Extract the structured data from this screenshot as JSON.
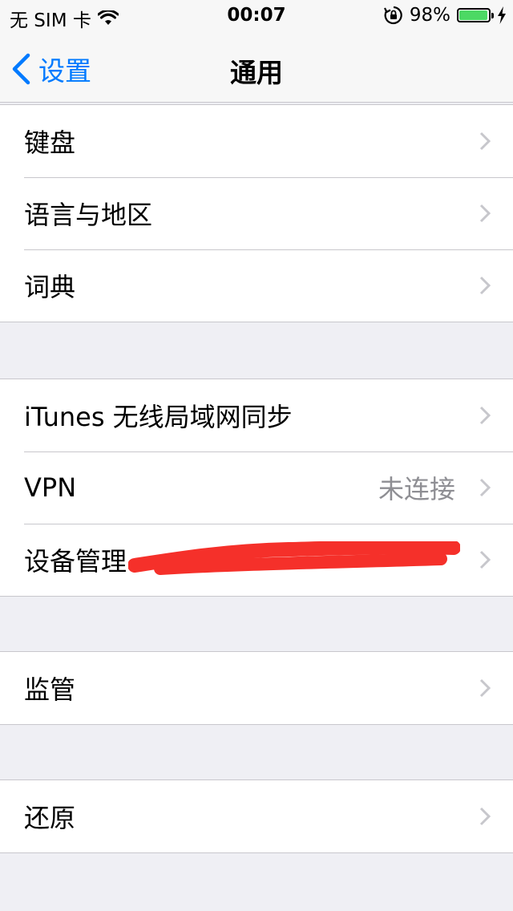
{
  "status_bar": {
    "carrier": "无 SIM 卡",
    "time": "00:07",
    "battery_percent": "98%",
    "battery_level": 0.98
  },
  "nav": {
    "back_label": "设置",
    "title": "通用"
  },
  "groups": [
    {
      "items": [
        {
          "label": "键盘"
        },
        {
          "label": "语言与地区"
        },
        {
          "label": "词典"
        }
      ]
    },
    {
      "items": [
        {
          "label": "iTunes 无线局域网同步"
        },
        {
          "label": "VPN",
          "value": "未连接"
        },
        {
          "label": "设备管理"
        }
      ]
    },
    {
      "items": [
        {
          "label": "监管"
        }
      ]
    },
    {
      "items": [
        {
          "label": "还原"
        }
      ]
    }
  ],
  "colors": {
    "accent": "#007aff",
    "background": "#efeff4",
    "separator": "#c8c7cc",
    "secondary_text": "#8e8e93",
    "chevron": "#c7c7cc",
    "battery": "#4cd964",
    "redaction": "#f5302a"
  }
}
